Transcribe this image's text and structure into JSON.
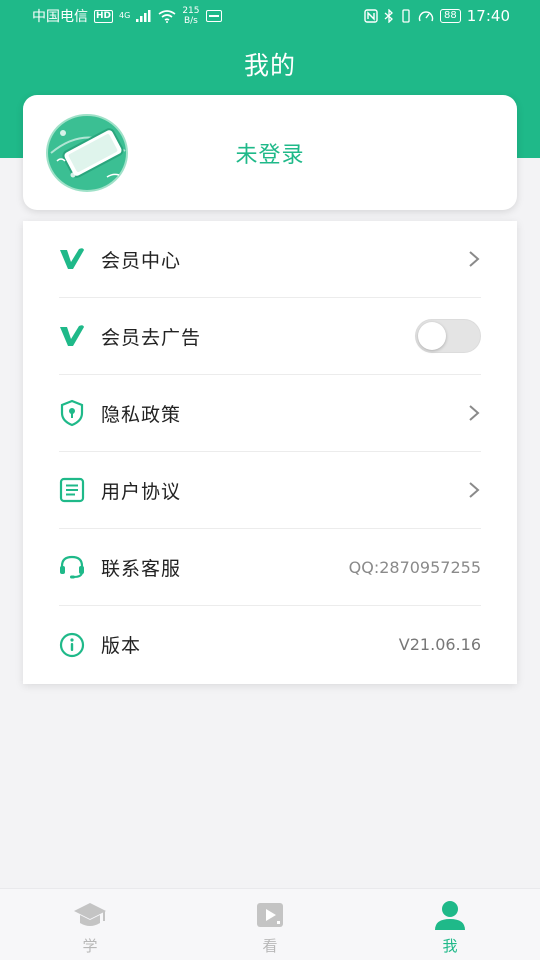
{
  "status_bar": {
    "carrier": "中国电信",
    "hd": "HD",
    "network": "4G",
    "speed_value": "215",
    "speed_unit": "B/s",
    "battery": "88",
    "time": "17:40"
  },
  "header": {
    "title": "我的"
  },
  "profile": {
    "login_status": "未登录"
  },
  "menu": {
    "items": [
      {
        "label": "会员中心",
        "icon": "vip-v-icon",
        "right": "chevron"
      },
      {
        "label": "会员去广告",
        "icon": "vip-v-icon",
        "right": "toggle",
        "toggle_on": false
      },
      {
        "label": "隐私政策",
        "icon": "shield-lock-icon",
        "right": "chevron"
      },
      {
        "label": "用户协议",
        "icon": "document-icon",
        "right": "chevron"
      },
      {
        "label": "联系客服",
        "icon": "headset-icon",
        "right": "text",
        "value": "QQ:2870957255"
      },
      {
        "label": "版本",
        "icon": "info-icon",
        "right": "text",
        "value": "V21.06.16"
      }
    ]
  },
  "bottom_nav": {
    "items": [
      {
        "label": "学",
        "icon": "graduation-cap-icon",
        "active": false
      },
      {
        "label": "看",
        "icon": "video-play-icon",
        "active": false
      },
      {
        "label": "我",
        "icon": "person-icon",
        "active": true
      }
    ]
  },
  "colors": {
    "accent": "#1fb989",
    "inactive": "#b8b8b8",
    "background": "#f3f3f5"
  }
}
